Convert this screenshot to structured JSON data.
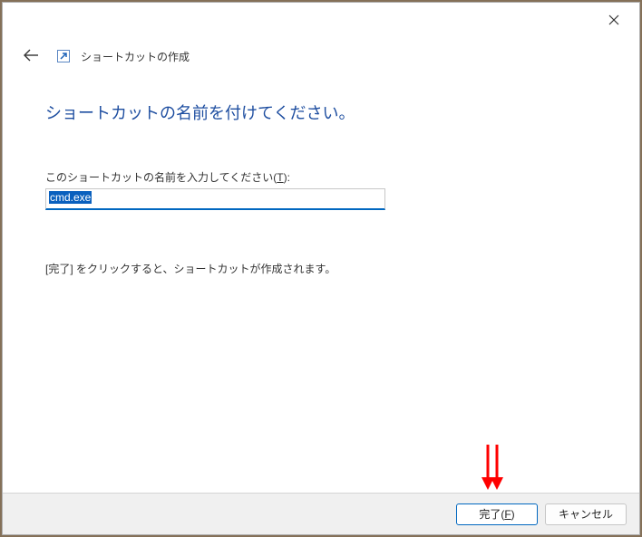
{
  "window": {
    "title": "ショートカットの作成"
  },
  "page": {
    "heading": "ショートカットの名前を付けてください。",
    "name_label_pre": "このショートカットの名前を入力してください(",
    "name_label_key": "T",
    "name_label_post": "):",
    "name_value": "cmd.exe",
    "instruction": "[完了] をクリックすると、ショートカットが作成されます。"
  },
  "buttons": {
    "finish_pre": "完了(",
    "finish_key": "F",
    "finish_post": ")",
    "cancel": "キャンセル"
  },
  "annotation": {
    "arrow_color": "#ff0000"
  }
}
